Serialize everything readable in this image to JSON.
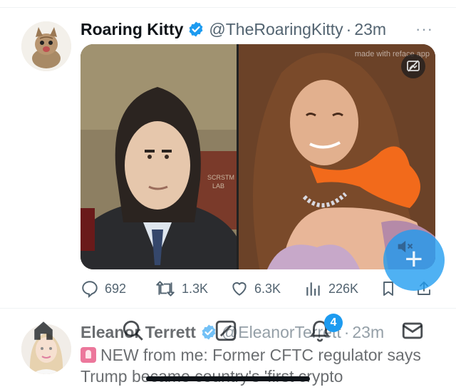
{
  "tweet1": {
    "name": "Roaring Kitty",
    "handle": "@TheRoaringKitty",
    "separator": "·",
    "time": "23m",
    "more": "···",
    "media_watermark": "made with reface app",
    "media_left_caption": "",
    "actions": {
      "replies": "692",
      "retweets": "1.3K",
      "likes": "6.3K",
      "views": "226K"
    }
  },
  "tweet2": {
    "name": "Eleanor Terrett",
    "handle": "@EleanorTerrett",
    "separator": "·",
    "time": "23m",
    "more": "···",
    "text_line1": "NEW from me: Former CFTC regulator says",
    "text_line2": "Trump became country's 'first crypto"
  },
  "tabbar": {
    "notifications_badge": "4"
  },
  "colors": {
    "accent": "#1d9bf0",
    "text": "#0f1419",
    "secondary": "#536471",
    "orange": "#f26a1b"
  }
}
